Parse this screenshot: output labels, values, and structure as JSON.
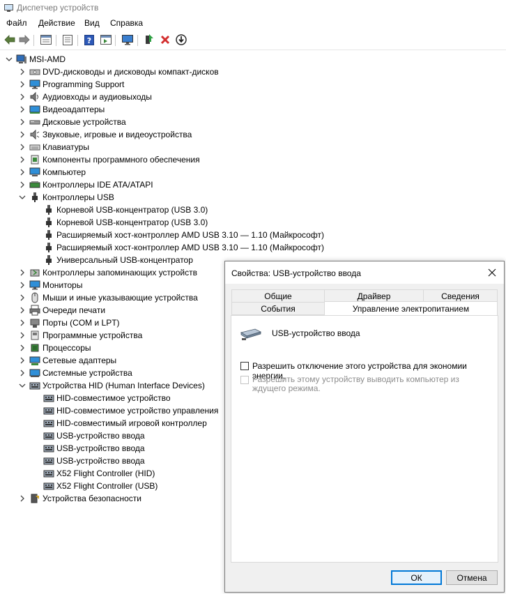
{
  "window": {
    "title": "Диспетчер устройств"
  },
  "menu": [
    "Файл",
    "Действие",
    "Вид",
    "Справка"
  ],
  "tree": {
    "root": "MSI-AMD",
    "items": [
      {
        "label": "DVD-дисководы и дисководы компакт-дисков",
        "level": 1,
        "state": "collapsed",
        "icon": "dvd-drive-icon"
      },
      {
        "label": "Programming Support",
        "level": 1,
        "state": "collapsed",
        "icon": "monitor-icon"
      },
      {
        "label": "Аудиовходы и аудиовыходы",
        "level": 1,
        "state": "collapsed",
        "icon": "audio-icon"
      },
      {
        "label": "Видеоадаптеры",
        "level": 1,
        "state": "collapsed",
        "icon": "display-adapter-icon"
      },
      {
        "label": "Дисковые устройства",
        "level": 1,
        "state": "collapsed",
        "icon": "disk-drive-icon"
      },
      {
        "label": "Звуковые, игровые и видеоустройства",
        "level": 1,
        "state": "collapsed",
        "icon": "speaker-icon"
      },
      {
        "label": "Клавиатуры",
        "level": 1,
        "state": "collapsed",
        "icon": "keyboard-icon"
      },
      {
        "label": "Компоненты программного обеспечения",
        "level": 1,
        "state": "collapsed",
        "icon": "software-component-icon"
      },
      {
        "label": "Компьютер",
        "level": 1,
        "state": "collapsed",
        "icon": "computer-icon"
      },
      {
        "label": "Контроллеры IDE ATA/ATAPI",
        "level": 1,
        "state": "collapsed",
        "icon": "ide-controller-icon"
      },
      {
        "label": "Контроллеры USB",
        "level": 1,
        "state": "expanded",
        "icon": "usb-icon"
      },
      {
        "label": "Корневой USB-концентратор (USB 3.0)",
        "level": 2,
        "state": "none",
        "icon": "usb-icon"
      },
      {
        "label": "Корневой USB-концентратор (USB 3.0)",
        "level": 2,
        "state": "none",
        "icon": "usb-icon"
      },
      {
        "label": "Расширяемый хост-контроллер AMD USB 3.10 — 1.10 (Майкрософт)",
        "level": 2,
        "state": "none",
        "icon": "usb-icon"
      },
      {
        "label": "Расширяемый хост-контроллер AMD USB 3.10 — 1.10 (Майкрософт)",
        "level": 2,
        "state": "none",
        "icon": "usb-icon"
      },
      {
        "label": "Универсальный USB-концентратор",
        "level": 2,
        "state": "none",
        "icon": "usb-icon"
      },
      {
        "label": "Контроллеры запоминающих устройств",
        "level": 1,
        "state": "collapsed",
        "icon": "storage-controller-icon"
      },
      {
        "label": "Мониторы",
        "level": 1,
        "state": "collapsed",
        "icon": "monitor-icon"
      },
      {
        "label": "Мыши и иные указывающие устройства",
        "level": 1,
        "state": "collapsed",
        "icon": "mouse-icon"
      },
      {
        "label": "Очереди печати",
        "level": 1,
        "state": "collapsed",
        "icon": "printer-icon"
      },
      {
        "label": "Порты (COM и LPT)",
        "level": 1,
        "state": "collapsed",
        "icon": "port-icon"
      },
      {
        "label": "Программные устройства",
        "level": 1,
        "state": "collapsed",
        "icon": "software-device-icon"
      },
      {
        "label": "Процессоры",
        "level": 1,
        "state": "collapsed",
        "icon": "processor-icon"
      },
      {
        "label": "Сетевые адаптеры",
        "level": 1,
        "state": "collapsed",
        "icon": "network-adapter-icon"
      },
      {
        "label": "Системные устройства",
        "level": 1,
        "state": "collapsed",
        "icon": "system-device-icon"
      },
      {
        "label": "Устройства HID (Human Interface Devices)",
        "level": 1,
        "state": "expanded",
        "icon": "hid-icon"
      },
      {
        "label": "HID-совместимое устройство",
        "level": 2,
        "state": "none",
        "icon": "hid-icon"
      },
      {
        "label": "HID-совместимое устройство управления",
        "level": 2,
        "state": "none",
        "icon": "hid-icon"
      },
      {
        "label": "HID-совместимый игровой контроллер",
        "level": 2,
        "state": "none",
        "icon": "hid-icon"
      },
      {
        "label": "USB-устройство ввода",
        "level": 2,
        "state": "none",
        "icon": "hid-icon"
      },
      {
        "label": "USB-устройство ввода",
        "level": 2,
        "state": "none",
        "icon": "hid-icon"
      },
      {
        "label": "USB-устройство ввода",
        "level": 2,
        "state": "none",
        "icon": "hid-icon"
      },
      {
        "label": "X52 Flight Controller (HID)",
        "level": 2,
        "state": "none",
        "icon": "hid-icon"
      },
      {
        "label": "X52 Flight Controller (USB)",
        "level": 2,
        "state": "none",
        "icon": "hid-icon"
      },
      {
        "label": "Устройства безопасности",
        "level": 1,
        "state": "collapsed",
        "icon": "security-device-icon"
      }
    ]
  },
  "dialog": {
    "title": "Свойства: USB-устройство ввода",
    "tabs_row1": [
      "Общие",
      "Драйвер",
      "Сведения"
    ],
    "tabs_row2": [
      "События",
      "Управление электропитанием"
    ],
    "active_tab": "Управление электропитанием",
    "device_name": "USB-устройство ввода",
    "checkbox_allow_off": {
      "label": "Разрешить отключение этого устройства для экономии энергии.",
      "checked": false,
      "enabled": true
    },
    "checkbox_wake": {
      "label": "Разрешить этому устройству выводить компьютер из ждущего режима.",
      "checked": false,
      "enabled": false
    },
    "ok": "ОК",
    "cancel": "Отмена"
  },
  "colors": {
    "accent": "#0078d7",
    "delete_red": "#d32f2f"
  }
}
